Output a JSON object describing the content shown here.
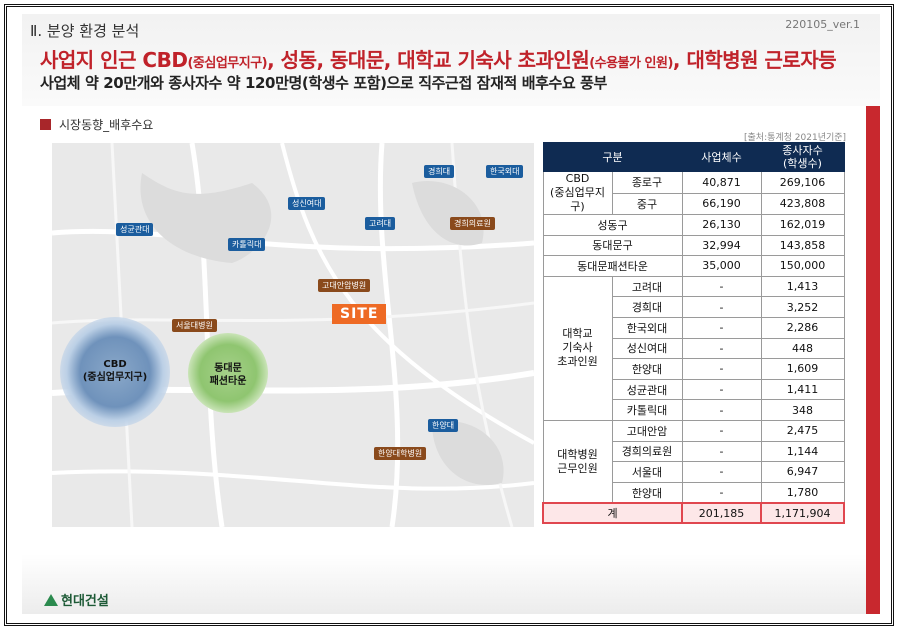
{
  "header": {
    "section_title": "Ⅱ. 분양 환경 분석",
    "version": "220105_ver.1",
    "headline_main": "사업지 인근 CBD",
    "headline_paren": "(중심업무지구)",
    "headline_mid": ", 성동, 동대문, 대학교 기숙사 초과인원",
    "headline_paren2": "(수용불가 인원)",
    "headline_end": ", 대학병원 근로자등",
    "subline": "사업체 약 20만개와 종사자수 약 120만명(학생수 포함)으로 직주근접 잠재적 배후수요 풍부"
  },
  "section_tag": "시장동향_배후수요",
  "source_note": "[출처:통계청 2021년기준]",
  "map": {
    "site_label": "SITE",
    "cbd_label_line1": "CBD",
    "cbd_label_line2": "(중심업무지구)",
    "ddm_label_line1": "동대문",
    "ddm_label_line2": "패션타운",
    "university_pins": [
      "경희대",
      "한국외대",
      "성신여대",
      "고려대",
      "성균관대",
      "카톨릭대",
      "한양대"
    ],
    "hospital_pins": [
      "경희의료원",
      "고대안암병원",
      "서울대병원",
      "한양대학병원"
    ]
  },
  "table": {
    "headers": {
      "category": "구분",
      "businesses": "사업체수",
      "employees": "종사자수",
      "employees_sub": "(학생수)"
    },
    "cbd_group": "CBD",
    "cbd_group_sub": "(중심업무지구)",
    "cbd_rows": [
      {
        "name": "종로구",
        "businesses": "40,871",
        "employees": "269,106"
      },
      {
        "name": "중구",
        "businesses": "66,190",
        "employees": "423,808"
      }
    ],
    "plain_rows": [
      {
        "name": "성동구",
        "businesses": "26,130",
        "employees": "162,019"
      },
      {
        "name": "동대문구",
        "businesses": "32,994",
        "employees": "143,858"
      },
      {
        "name": "동대문패션타운",
        "businesses": "35,000",
        "employees": "150,000"
      }
    ],
    "univ_group_l1": "대학교",
    "univ_group_l2": "기숙사",
    "univ_group_l3": "초과인원",
    "univ_rows": [
      {
        "name": "고려대",
        "businesses": "-",
        "employees": "1,413"
      },
      {
        "name": "경희대",
        "businesses": "-",
        "employees": "3,252"
      },
      {
        "name": "한국외대",
        "businesses": "-",
        "employees": "2,286"
      },
      {
        "name": "성신여대",
        "businesses": "-",
        "employees": "448"
      },
      {
        "name": "한양대",
        "businesses": "-",
        "employees": "1,609"
      },
      {
        "name": "성균관대",
        "businesses": "-",
        "employees": "1,411"
      },
      {
        "name": "카톨릭대",
        "businesses": "-",
        "employees": "348"
      }
    ],
    "hosp_group_l1": "대학병원",
    "hosp_group_l2": "근무인원",
    "hosp_rows": [
      {
        "name": "고대안암",
        "businesses": "-",
        "employees": "2,475"
      },
      {
        "name": "경희의료원",
        "businesses": "-",
        "employees": "1,144"
      },
      {
        "name": "서울대",
        "businesses": "-",
        "employees": "6,947"
      },
      {
        "name": "한양대",
        "businesses": "-",
        "employees": "1,780"
      }
    ],
    "total": {
      "name": "계",
      "businesses": "201,185",
      "employees": "1,171,904"
    }
  },
  "footer": {
    "logo_text": "현대건설"
  },
  "colors": {
    "accent_red": "#c0222a",
    "table_header": "#0f2b52",
    "site_orange": "#ee6a24",
    "pin_blue": "#1b5d9e",
    "pin_brown": "#8a4a1c"
  }
}
